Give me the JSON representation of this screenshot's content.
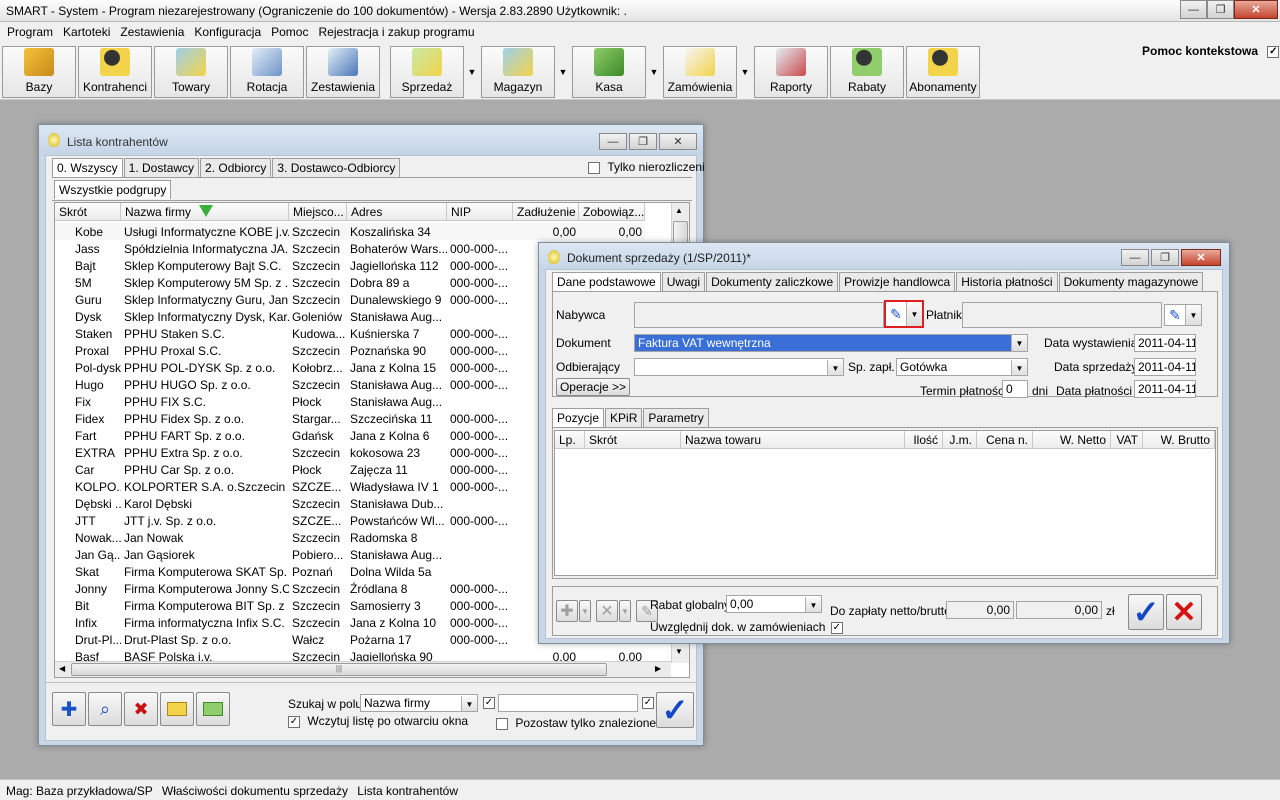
{
  "app": {
    "title": "SMART - System - Program niezarejestrowany (Ograniczenie do 100 dokumentów) - Wersja 2.83.2890   Użytkownik: .",
    "min": "—",
    "max": "❐",
    "close": "✕"
  },
  "menu": [
    "Program",
    "Kartoteki",
    "Zestawienia",
    "Konfiguracja",
    "Pomoc",
    "Rejestracja i zakup programu"
  ],
  "toolbar": {
    "buttons": [
      "Bazy",
      "Kontrahenci",
      "Towary",
      "Rotacja",
      "Zestawienia",
      "Sprzedaż",
      "Magazyn",
      "Kasa",
      "Zamówienia",
      "Raporty",
      "Rabaty",
      "Abonamenty"
    ],
    "help": "Pomoc kontekstowa",
    "help_checked": "✓",
    "arrow": "▼"
  },
  "colors": {
    "accent": "#3a6fd8",
    "close_red": "#c4442d",
    "confirm_blue": "#1446c8",
    "cancel_red": "#d81010"
  },
  "list": {
    "title": "Lista kontrahentów",
    "tabs": [
      "0. Wszyscy",
      "1. Dostawcy",
      "2. Odbiorcy",
      "3. Dostawco-Odbiorcy"
    ],
    "only_unsettled": "Tylko nierozliczeni",
    "subgroup_tab": "Wszystkie podgrupy",
    "columns": [
      "Skrót",
      "Nazwa firmy",
      "Miejsco...",
      "Adres",
      "NIP",
      "Zadłużenie",
      "Zobowiąz..."
    ],
    "rows": [
      [
        "Kobe",
        "Usługi Informatyczne KOBE j.v.",
        "Szczecin",
        "Koszalińska 34",
        "",
        "0,00",
        "0,00"
      ],
      [
        "Jass",
        "Spółdzielnia Informatyczna JA...",
        "Szczecin",
        "Bohaterów Wars...",
        "000-000-...",
        "",
        ""
      ],
      [
        "Bajt",
        "Sklep Komputerowy Bajt S.C.",
        "Szczecin",
        "Jagiellońska 112",
        "000-000-...",
        "",
        ""
      ],
      [
        "5M",
        "Sklep Komputerowy 5M Sp. z ...",
        "Szczecin",
        "Dobra 89 a",
        "000-000-...",
        "",
        ""
      ],
      [
        "Guru",
        "Sklep Informatyczny Guru, Jan...",
        "Szczecin",
        "Dunalewskiego 9",
        "000-000-...",
        "",
        ""
      ],
      [
        "Dysk",
        "Sklep Informatyczny Dysk, Kar...",
        "Goleniów",
        "Stanisława Aug...",
        "",
        "",
        ""
      ],
      [
        "Staken",
        "PPHU Staken S.C.",
        "Kudowa...",
        "Kuśnierska 7",
        "000-000-...",
        "",
        ""
      ],
      [
        "Proxal",
        "PPHU Proxal S.C.",
        "Szczecin",
        "Poznańska 90",
        "000-000-...",
        "",
        ""
      ],
      [
        "Pol-dysk",
        "PPHU POL-DYSK Sp. z o.o.",
        "Kołobrz...",
        "Jana z Kolna 15",
        "000-000-...",
        "",
        ""
      ],
      [
        "Hugo",
        "PPHU HUGO Sp. z o.o.",
        "Szczecin",
        "Stanisława Aug...",
        "000-000-...",
        "",
        ""
      ],
      [
        "Fix",
        "PPHU FIX S.C.",
        "Płock",
        "Stanisława Aug...",
        "",
        "",
        ""
      ],
      [
        "Fidex",
        "PPHU Fidex Sp. z o.o.",
        "Stargar...",
        "Szczecińska 11",
        "000-000-...",
        "",
        ""
      ],
      [
        "Fart",
        "PPHU FART Sp. z o.o.",
        "Gdańsk",
        "Jana z Kolna 6",
        "000-000-...",
        "",
        ""
      ],
      [
        "EXTRA",
        "PPHU Extra Sp. z o.o.",
        "Szczecin",
        "kokosowa 23",
        "000-000-...",
        "",
        ""
      ],
      [
        "Car",
        "PPHU Car Sp. z o.o.",
        "Płock",
        "Zajęcza 11",
        "000-000-...",
        "",
        ""
      ],
      [
        "KOLPO...",
        "KOLPORTER S.A. o.Szczecin",
        "SZCZE...",
        "Władysława IV 1",
        "000-000-...",
        "",
        ""
      ],
      [
        "Dębski ...",
        "Karol Dębski",
        "Szczecin",
        "Stanisława Dub...",
        "",
        "",
        ""
      ],
      [
        "JTT",
        "JTT j.v. Sp. z o.o.",
        "SZCZE...",
        "Powstańców Wl...",
        "000-000-...",
        "",
        ""
      ],
      [
        "Nowak...",
        "Jan Nowak",
        "Szczecin",
        "Radomska 8",
        "",
        "",
        ""
      ],
      [
        "Jan Gą...",
        "Jan Gąsiorek",
        "Pobiero...",
        "Stanisława Aug...",
        "",
        "",
        ""
      ],
      [
        "Skat",
        "Firma Komputerowa SKAT Sp. ...",
        "Poznań",
        "Dolna Wilda 5a",
        "",
        "",
        ""
      ],
      [
        "Jonny",
        "Firma Komputerowa Jonny S.C.",
        "Szczecin",
        "Źródlana 8",
        "000-000-...",
        "",
        ""
      ],
      [
        "Bit",
        "Firma Komputerowa BIT Sp. z ...",
        "Szczecin",
        "Samosierry 3",
        "000-000-...",
        "",
        ""
      ],
      [
        "Infix",
        "Firma informatyczna Infix S.C.",
        "Szczecin",
        "Jana z Kolna 10",
        "000-000-...",
        "",
        ""
      ],
      [
        "Drut-Pl...",
        "Drut-Plast Sp. z o.o.",
        "Wałcz",
        "Pożarna 17",
        "000-000-...",
        "",
        ""
      ],
      [
        "Basf",
        "BASF Polska j.v.",
        "Szczecin",
        "Jagiellońska 90",
        "",
        "0,00",
        "0,00"
      ]
    ],
    "search_label": "Szukaj w polu:",
    "search_field": "Nazwa firmy",
    "search_value": "",
    "load_on_open": "Wczytuj listę po otwarciu okna",
    "leave_found": "Pozostaw tylko znalezione",
    "scroll_mid": "|||"
  },
  "doc": {
    "title": "Dokument sprzedaży (1/SP/2011)*",
    "tabs": [
      "Dane podstawowe",
      "Uwagi",
      "Dokumenty zaliczkowe",
      "Prowizje handlowca",
      "Historia płatności",
      "Dokumenty magazynowe"
    ],
    "buyer_label": "Nabywca",
    "buyer": "",
    "payer_label": "Płatnik",
    "payer": "",
    "document_label": "Dokument",
    "document": "Faktura VAT wewnętrzna",
    "receiver_label": "Odbierający",
    "receiver": "",
    "pay_method_label": "Sp. zapł.",
    "pay_method": "Gotówka",
    "operations": "Operacje >>",
    "issue_date_label": "Data wystawienia",
    "issue_date": "2011-04-11",
    "sale_date_label": "Data sprzedaży",
    "sale_date": "2011-04-11",
    "term_label": "Termin płatności",
    "term": "0",
    "term_unit": "dni",
    "pay_date_label": "Data płatności",
    "pay_date": "2011-04-11",
    "item_tabs": [
      "Pozycje",
      "KPiR",
      "Parametry"
    ],
    "columns": [
      "Lp.",
      "Skrót",
      "Nazwa towaru",
      "Ilość",
      "J.m.",
      "Cena n.",
      "W. Netto",
      "VAT",
      "W. Brutto"
    ],
    "discount_label": "Rabat globalny",
    "discount": "0,00",
    "include_orders": "Uwzględnij dok. w zamówieniach",
    "to_pay_label": "Do zapłaty netto/brutto",
    "net": "0,00",
    "gross": "0,00",
    "currency": "zł"
  },
  "status": [
    "Mag: Baza przykładowa/SP",
    "Właściwości dokumentu sprzedaży",
    "Lista kontrahentów"
  ]
}
